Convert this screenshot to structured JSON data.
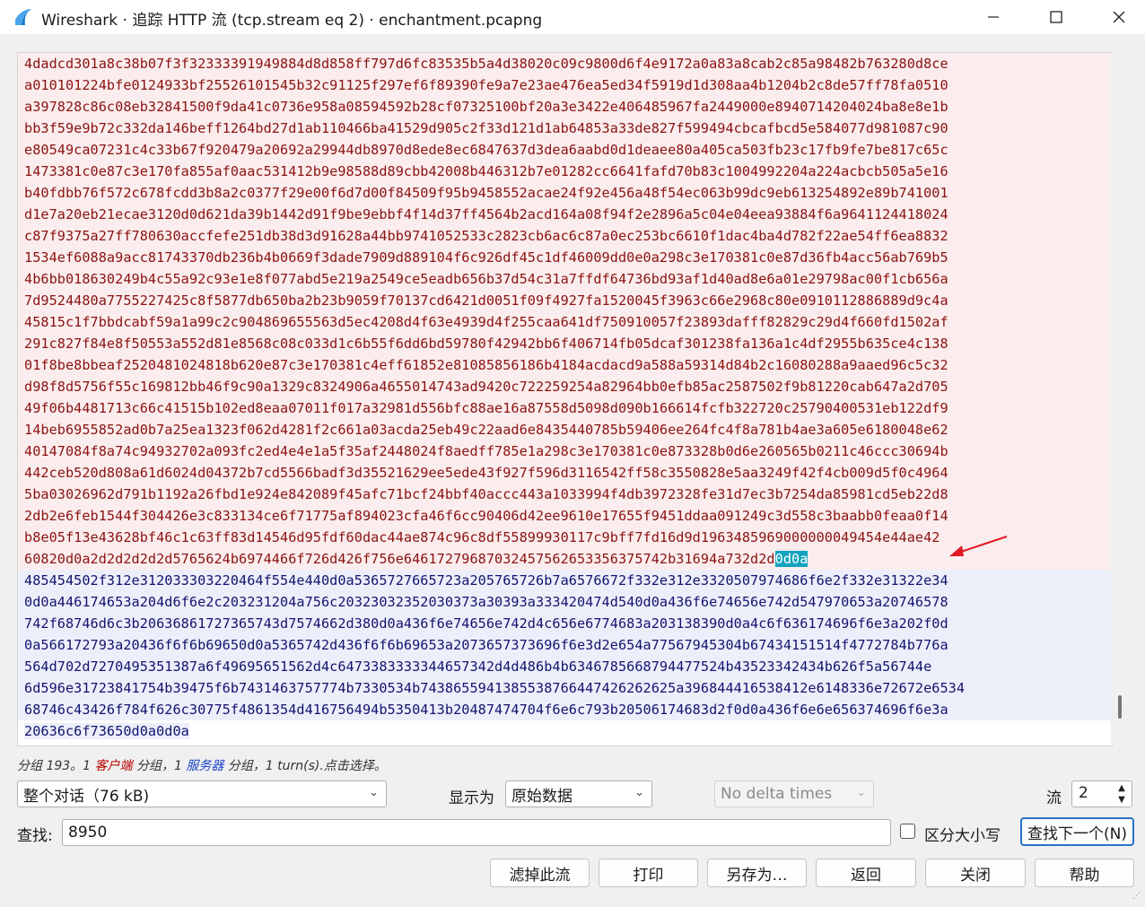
{
  "window": {
    "title": "Wireshark · 追踪 HTTP 流 (tcp.stream eq 2) · enchantment.pcapng"
  },
  "stream": {
    "client_lines": [
      "4dadcd301a8c38b07f3f32333391949884d8d858ff797d6fc83535b5a4d38020c09c9800d6f4e9172a0a83a8cab2c85a98482b763280d8ce",
      "a010101224bfe0124933bf25526101545b32c91125f297ef6f89390fe9a7e23ae476ea5ed34f5919d1d308aa4b1204b2c8de57ff78fa0510",
      "a397828c86c08eb32841500f9da41c0736e958a08594592b28cf07325100bf20a3e3422e406485967fa2449000e8940714204024ba8e8e1b",
      "bb3f59e9b72c332da146beff1264bd27d1ab110466ba41529d905c2f33d121d1ab64853a33de827f599494cbcafbcd5e584077d981087c90",
      "e80549ca07231c4c33b67f920479a20692a29944db8970d8ede8ec6847637d3dea6aabd0d1deaee80a405ca503fb23c17fb9fe7be817c65c",
      "1473381c0e87c3e170fa855af0aac531412b9e98588d89cbb42008b446312b7e01282cc6641fafd70b83c1004992204a224acbcb505a5e16",
      "b40fdbb76f572c678fcdd3b8a2c0377f29e00f6d7d00f84509f95b9458552acae24f92e456a48f54ec063b99dc9eb613254892e89b741001",
      "d1e7a20eb21ecae3120d0d621da39b1442d91f9be9ebbf4f14d37ff4564b2acd164a08f94f2e2896a5c04e04eea93884f6a9641124418024",
      "c87f9375a27ff780630accfefe251db38d3d91628a44bb9741052533c2823cb6ac6c87a0ec253bc6610f1dac4ba4d782f22ae54ff6ea8832",
      "1534ef6088a9acc81743370db236b4b0669f3dade7909d889104f6c926df45c1df46009dd0e0a298c3e170381c0e87d36fb4acc56ab769b5",
      "4b6bb018630249b4c55a92c93e1e8f077abd5e219a2549ce5eadb656b37d54c31a7ffdf64736bd93af1d40ad8e6a01e29798ac00f1cb656a",
      "7d9524480a7755227425c8f5877db650ba2b23b9059f70137cd6421d0051f09f4927fa1520045f3963c66e2968c80e0910112886889d9c4a",
      "45815c1f7bbdcabf59a1a99c2c904869655563d5ec4208d4f63e4939d4f255caa641df750910057f23893dafff82829c29d4f660fd1502af",
      "291c827f84e8f50553a552d81e8568c08c033d1c6b55f6dd6bd59780f42942bb6f406714fb05dcaf301238fa136a1c4df2955b635ce4c138",
      "01f8be8bbeaf2520481024818b620e87c3e170381c4eff61852e81085856186b4184acdacd9a588a59314d84b2c16080288a9aaed96c5c32",
      "d98f8d5756f55c169812bb46f9c90a1329c8324906a4655014743ad9420c722259254a82964bb0efb85ac2587502f9b81220cab647a2d705",
      "49f06b4481713c66c41515b102ed8eaa07011f017a32981d556bfc88ae16a87558d5098d090b166614fcfb322720c25790400531eb122df9",
      "14beb6955852ad0b7a25ea1323f062d4281f2c661a03acda25eb49c22aad6e8435440785b59406ee264fc4f8a781b4ae3a605e6180048e62",
      "40147084f8a74c94932702a093fc2ed4e4e1a5f35af2448024f8aedff785e1a298c3e170381c0e873328b0d6e260565b0211c46ccc30694b",
      "442ceb520d808a61d6024d04372b7cd5566badf3d35521629ee5ede43f927f596d3116542ff58c3550828e5aa3249f42f4cb009d5f0c4964",
      "5ba03026962d791b1192a26fbd1e924e842089f45afc71bcf24bbf40accc443a1033994f4db3972328fe31d7ec3b7254da85981cd5eb22d8",
      "2db2e6feb1544f304426e3c833134ce6f71775af894023cfa46f6cc90406d42ee9610e17655f9451ddaa091249c3d558c3baabb0feaa0f14",
      "b8e05f13e43628bf46c1c63ff83d14546d95fdf60dac44ae874c96c8df55899930117c9bff7fd16d9d1963485969000000049454e44ae42"
    ],
    "client_last_line": "60820d0a2d2d2d2d2d5765624b6974466f726d426f756e64617279687032457562653356375742b31694a732d2d",
    "highlight": "0d0a",
    "server_lines": [
      "485454502f312e312033303220464f554e440d0a5365727665723a205765726b7a6576672f332e312e3320507974686f6e2f332e31322e34",
      "0d0a446174653a204d6f6e2c203231204a756c20323032352030373a30393a333420474d540d0a436f6e74656e742d547970653a20746578",
      "742f68746d6c3b20636861727365743d7574662d380d0a436f6e74656e742d4c656e6774683a203138390d0a4c6f636174696f6e3a202f0d",
      "0a566172793a20436f6f6b69650d0a5365742d436f6f6b69653a2073657373696f6e3d2e654a77567945304b67434151514f4772784b776a",
      "564d702d7270495351387a6f49695651562d4c6473383333344657342d4d486b4b6346785668794477524b43523342434b626f5a56744e",
      "6d596e31723841754b39475f6b7431463757774b7330534b7438655941385538766447426262625a396844416538412e6148336e72672e6534",
      "68746c43426f784f626c30775f4861354d416756494b5350413b20487474704f6e6c793b20506174683d2f0d0a436f6e6e656374696f6e3a",
      "20636c6f73650d0a0d0a"
    ]
  },
  "status": {
    "prefix": "分组 193。1 ",
    "client_word": "客户端",
    "mid": " 分组，1 ",
    "server_word": "服务器",
    "suffix": " 分组，1 turn(s).点击选择。"
  },
  "controls": {
    "conversation_select": "整个对话（76 kB)",
    "show_as_label": "显示为",
    "show_as_value": "原始数据",
    "delta_select": "No delta times",
    "stream_label": "流",
    "stream_value": "2",
    "find_label": "查找:",
    "find_value": "8950",
    "case_sensitive_label": "区分大小写",
    "find_next": "查找下一个(N)"
  },
  "buttons": {
    "filter_out": "滤掉此流",
    "print": "打印",
    "save_as": "另存为…",
    "back": "返回",
    "close": "关闭",
    "help": "帮助"
  },
  "colors": {
    "client_bg": "#fbeded",
    "client_fg": "#8b1212",
    "server_bg": "#eceffa",
    "server_fg": "#13136e",
    "highlight": "#11a3be",
    "arrow": "#e01b24"
  }
}
